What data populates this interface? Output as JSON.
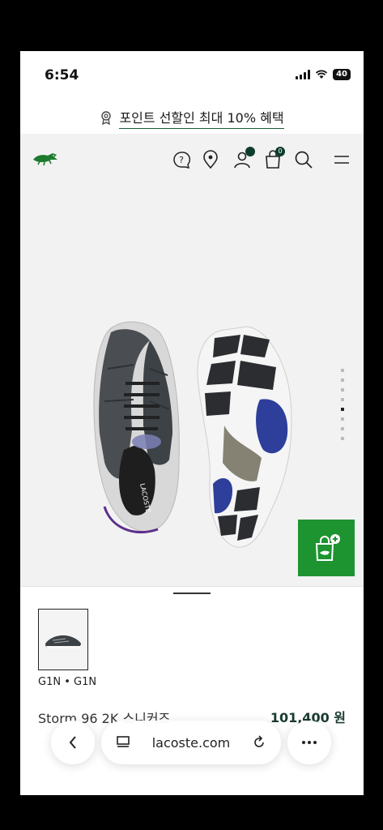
{
  "status": {
    "time": "6:54",
    "battery": "40"
  },
  "promo": {
    "text": "포인트 선할인 최대 10% 혜택"
  },
  "nav": {
    "cart_count": "0"
  },
  "gallery": {
    "slide_count": 8,
    "active_index": 5
  },
  "product": {
    "color_code": "G1N • G1N",
    "name": "Storm 96 2K 스니커즈",
    "price": "101,400 원"
  },
  "browser": {
    "url": "lacoste.com"
  },
  "colors": {
    "brand_green": "#1e9430",
    "dark_green": "#0d3d2a"
  }
}
